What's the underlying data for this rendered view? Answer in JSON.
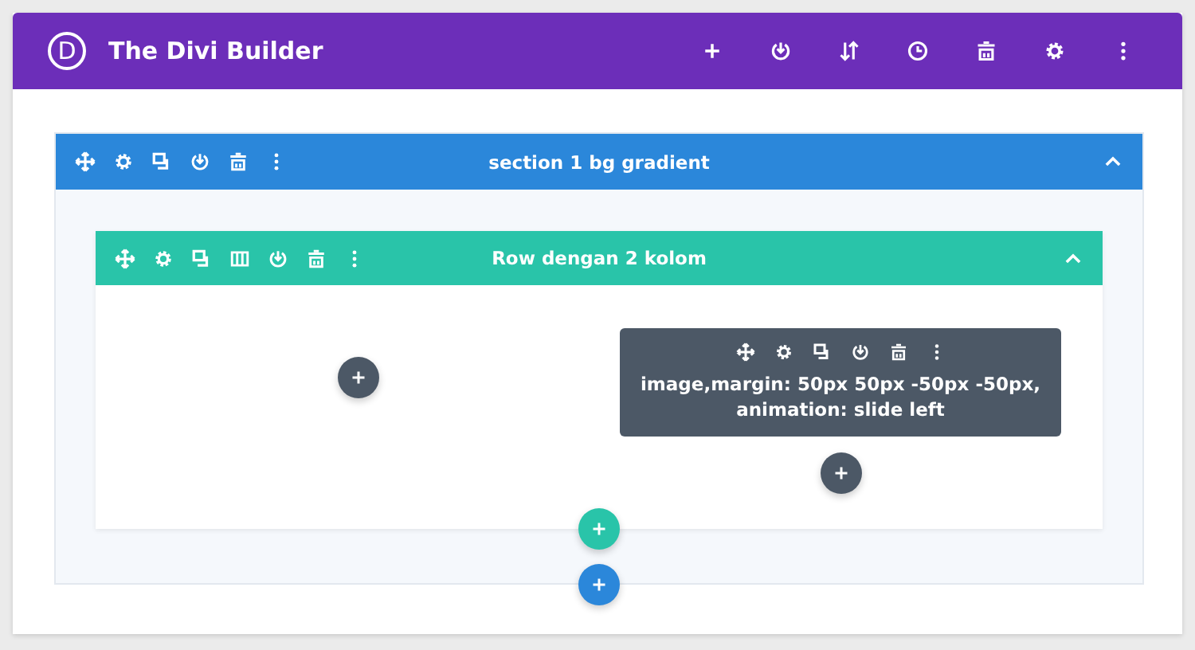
{
  "header": {
    "logo_letter": "D",
    "title": "The Divi Builder"
  },
  "section": {
    "title": "section 1 bg gradient"
  },
  "row": {
    "title": "Row dengan 2 kolom"
  },
  "module": {
    "text": "image,margin: 50px 50px -50px -50px, animation: slide left"
  }
}
